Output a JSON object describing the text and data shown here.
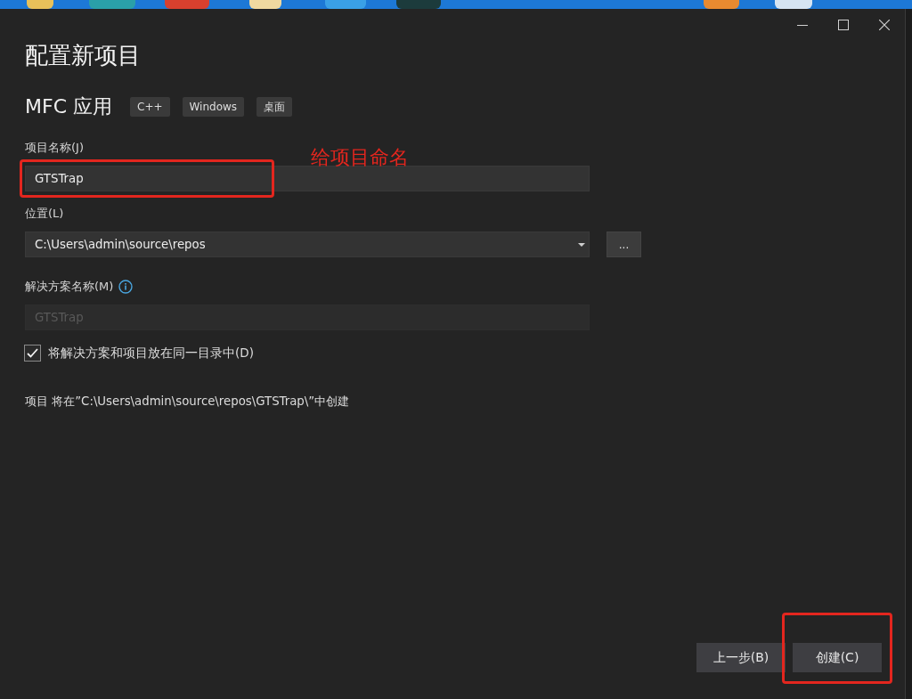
{
  "title": "配置新项目",
  "project_type": {
    "name": "MFC 应用",
    "tags": [
      "C++",
      "Windows",
      "桌面"
    ]
  },
  "fields": [
    {
      "kind": "text",
      "label": "项目名称(J)",
      "value": "GTSTrap",
      "disabled": false,
      "highlighted": true,
      "note": "给项目命名"
    },
    {
      "kind": "combo",
      "label": "位置(L)",
      "value": "C:\\Users\\admin\\source\\repos",
      "button": "..."
    },
    {
      "kind": "text",
      "label": "解决方案名称(M)",
      "value": "GTSTrap",
      "disabled": true,
      "info": true
    }
  ],
  "checkbox": {
    "label": "将解决方案和项目放在同一目录中(D)",
    "checked": true
  },
  "summary": "项目 将在”C:\\Users\\admin\\source\\repos\\GTSTrap\\”中创建",
  "buttons": [
    {
      "label": "上一步(B)"
    },
    {
      "label": "创建(C)",
      "highlighted": true
    }
  ]
}
